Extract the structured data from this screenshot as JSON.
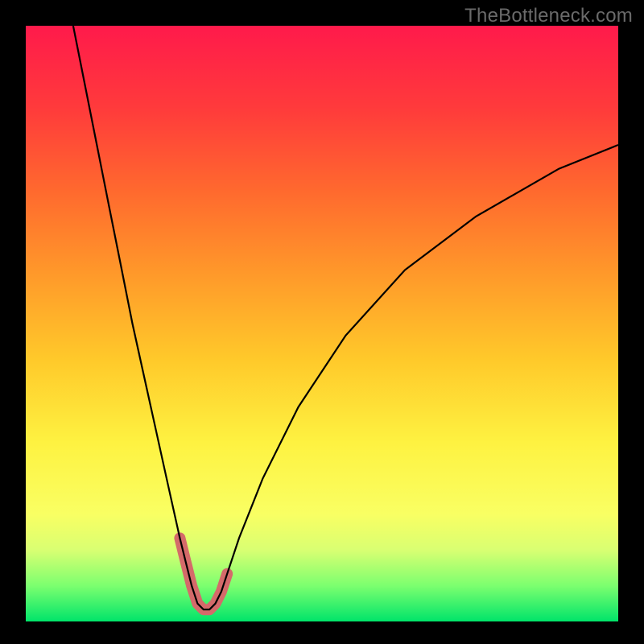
{
  "watermark": "TheBottleneck.com",
  "chart_data": {
    "type": "line",
    "title": "",
    "xlabel": "",
    "ylabel": "",
    "xlim": [
      0,
      100
    ],
    "ylim": [
      0,
      100
    ],
    "series": [
      {
        "name": "bottleneck-curve",
        "x": [
          8,
          10,
          12,
          14,
          16,
          18,
          20,
          22,
          24,
          26,
          27,
          28,
          29,
          30,
          31,
          32,
          33,
          34,
          36,
          40,
          46,
          54,
          64,
          76,
          90,
          100
        ],
        "values": [
          100,
          90,
          80,
          70,
          60,
          50,
          41,
          32,
          23,
          14,
          10,
          6,
          3,
          2,
          2,
          3,
          5,
          8,
          14,
          24,
          36,
          48,
          59,
          68,
          76,
          80
        ]
      }
    ],
    "highlight": {
      "name": "minimum-region",
      "x": [
        26,
        27,
        28,
        29,
        30,
        31,
        32,
        33,
        34
      ],
      "values": [
        14,
        10,
        6,
        3,
        2,
        2,
        3,
        5,
        8
      ]
    },
    "background_gradient": [
      "#ff1a4b",
      "#ff6a2e",
      "#ffc92a",
      "#f9ff63",
      "#00e46a"
    ]
  }
}
